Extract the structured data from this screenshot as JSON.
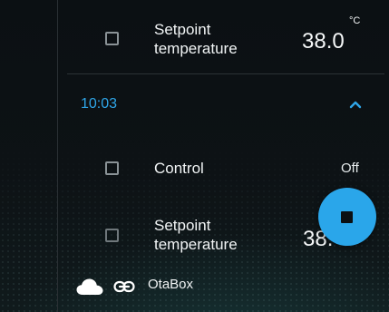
{
  "rows": [
    {
      "label_line1": "Setpoint",
      "label_line2": "temperature",
      "value": "38.0",
      "unit": "°C",
      "checked": false
    },
    {
      "label": "Control",
      "value": "Off",
      "checked": false
    },
    {
      "label_line1": "Setpoint",
      "label_line2": "temperature",
      "value": "38.",
      "checked": false
    }
  ],
  "group": {
    "time": "10:03",
    "expanded": true
  },
  "footer": {
    "device_name": "OtaBox",
    "icons": [
      "cloud-icon",
      "link-icon"
    ]
  },
  "fab": {
    "icon": "stop-icon"
  },
  "colors": {
    "accent": "#2aa6ea",
    "time_text": "#2fa6e8",
    "background": "#0b0f12"
  }
}
